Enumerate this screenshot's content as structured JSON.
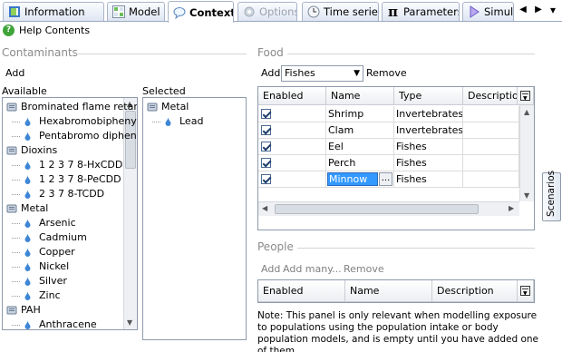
{
  "tabs": [
    {
      "label": "Information",
      "icon": "flag-icon",
      "active": false,
      "disabled": false
    },
    {
      "label": "Model",
      "icon": "model-grid-icon",
      "active": false,
      "disabled": false
    },
    {
      "label": "Context",
      "icon": "speech-bubble-icon",
      "active": true,
      "disabled": false
    },
    {
      "label": "Options",
      "icon": "options-gear-icon",
      "active": false,
      "disabled": true
    },
    {
      "label": "Time series",
      "icon": "clock-icon",
      "active": false,
      "disabled": false
    },
    {
      "label": "Parameters",
      "icon": "pi-icon",
      "active": false,
      "disabled": false
    },
    {
      "label": "Simula",
      "icon": "play-triangle-icon",
      "active": false,
      "disabled": false
    }
  ],
  "help": {
    "label": "Help Contents"
  },
  "contaminants": {
    "title": "Contaminants",
    "add_label": "Add",
    "available_label": "Available",
    "selected_label": "Selected",
    "available_tree": [
      {
        "label": "Brominated flame retar",
        "level": 0
      },
      {
        "label": "Hexabromobipheny",
        "level": 1
      },
      {
        "label": "Pentabromo diphen",
        "level": 1
      },
      {
        "label": "Dioxins",
        "level": 0
      },
      {
        "label": "1 2 3 7 8-HxCDD",
        "level": 1
      },
      {
        "label": "1 2 3 7 8-PeCDD",
        "level": 1
      },
      {
        "label": "2 3 7 8-TCDD",
        "level": 1
      },
      {
        "label": "Metal",
        "level": 0
      },
      {
        "label": "Arsenic",
        "level": 1
      },
      {
        "label": "Cadmium",
        "level": 1
      },
      {
        "label": "Copper",
        "level": 1
      },
      {
        "label": "Nickel",
        "level": 1
      },
      {
        "label": "Silver",
        "level": 1
      },
      {
        "label": "Zinc",
        "level": 1
      },
      {
        "label": "PAH",
        "level": 0
      },
      {
        "label": "Anthracene",
        "level": 1
      }
    ],
    "selected_tree": [
      {
        "label": "Metal",
        "level": 0
      },
      {
        "label": "Lead",
        "level": 1
      }
    ]
  },
  "food": {
    "title": "Food",
    "add_label": "Add",
    "combo_value": "Fishes",
    "remove_label": "Remove",
    "columns": [
      "Enabled",
      "Name",
      "Type",
      "Description"
    ],
    "rows": [
      {
        "enabled": true,
        "name": "Shrimp",
        "type": "Invertebrates",
        "description": ""
      },
      {
        "enabled": true,
        "name": "Clam",
        "type": "Invertebrates",
        "description": ""
      },
      {
        "enabled": true,
        "name": "Eel",
        "type": "Fishes",
        "description": ""
      },
      {
        "enabled": true,
        "name": "Perch",
        "type": "Fishes",
        "description": ""
      },
      {
        "enabled": true,
        "name": "Minnow",
        "type": "Fishes",
        "description": ""
      }
    ],
    "ellipsis": "..."
  },
  "people": {
    "title": "People",
    "add_label": "Add",
    "add_many_label": "Add many...",
    "remove_label": "Remove",
    "columns": [
      "Enabled",
      "Name",
      "Description"
    ]
  },
  "note": "Note: This panel is only relevant when modelling exposure to populations using the population intake or body population models, and is empty until you have added one of them.",
  "scenarios_label": "Scenarios",
  "colors": {
    "accent": "#3c7fd1",
    "droplet": "#3e86d6",
    "selection": "#3399ff"
  }
}
